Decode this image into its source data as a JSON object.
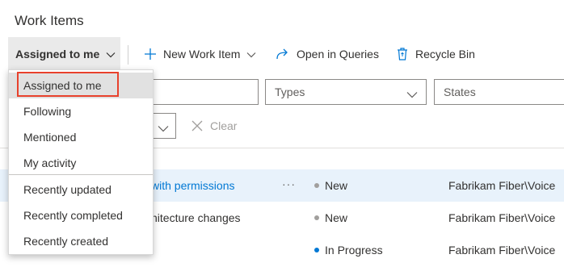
{
  "page": {
    "title": "Work Items"
  },
  "toolbar": {
    "view_label": "Assigned to me",
    "new_item_label": "New Work Item",
    "open_queries_label": "Open in Queries",
    "recycle_bin_label": "Recycle Bin"
  },
  "filters": {
    "keyword_placeholder": "",
    "types_label": "Types",
    "states_label": "States",
    "clear_label": "Clear"
  },
  "menu": {
    "items": [
      {
        "label": "Assigned to me"
      },
      {
        "label": "Following"
      },
      {
        "label": "Mentioned"
      },
      {
        "label": "My activity"
      },
      {
        "label": "Recently updated"
      },
      {
        "label": "Recently completed"
      },
      {
        "label": "Recently created"
      }
    ],
    "selected_index": 0
  },
  "rows": [
    {
      "title": "with permissions",
      "state": "New",
      "state_color": "#a19f9d",
      "area": "Fabrikam Fiber\\Voice"
    },
    {
      "title": "hitecture changes",
      "state": "New",
      "state_color": "#a19f9d",
      "area": "Fabrikam Fiber\\Voice"
    },
    {
      "title": "",
      "state": "In Progress",
      "state_color": "#0078d4",
      "area": "Fabrikam Fiber\\Voice"
    }
  ],
  "colors": {
    "accent": "#0078d4",
    "highlight": "#e8412c"
  },
  "icons": {
    "new_item": "plus-icon",
    "open_queries": "redirect-arrow-icon",
    "recycle_bin": "recycle-bin-icon",
    "clear": "close-icon",
    "dropdown": "chevron-down-icon"
  }
}
